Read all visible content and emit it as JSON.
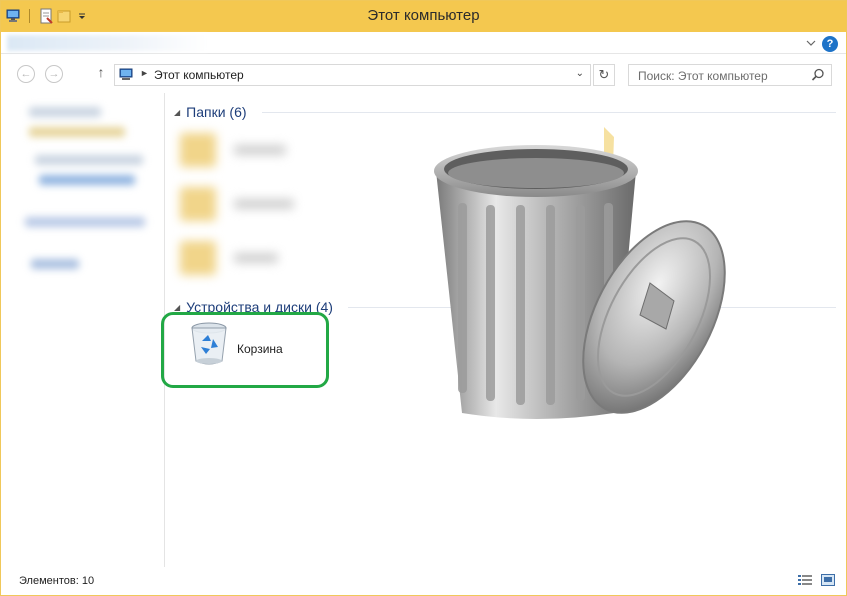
{
  "window": {
    "title": "Этот компьютер"
  },
  "navigation": {
    "address_path": "Этот компьютер",
    "search_placeholder": "Поиск: Этот компьютер"
  },
  "groups": [
    {
      "label": "Папки (6)"
    },
    {
      "label": "Устройства и диски (4)"
    }
  ],
  "items": {
    "recycle_bin_label": "Корзина"
  },
  "status": {
    "item_count": "Элементов: 10"
  },
  "colors": {
    "titlebar": "#f4c84f",
    "highlight": "#22a845",
    "group_header": "#1e3e7a"
  },
  "icons": {
    "window_icon": "computer-icon",
    "properties": "properties-icon",
    "new_folder": "new-folder-icon",
    "customize": "chevron-down-icon",
    "help": "help-icon",
    "back": "arrow-left-icon",
    "forward": "arrow-right-icon",
    "up": "arrow-up-icon",
    "refresh": "refresh-icon",
    "search": "search-icon",
    "recycle_bin": "recycle-bin-icon",
    "details_view": "details-view-icon",
    "large_icons_view": "large-icons-view-icon"
  }
}
